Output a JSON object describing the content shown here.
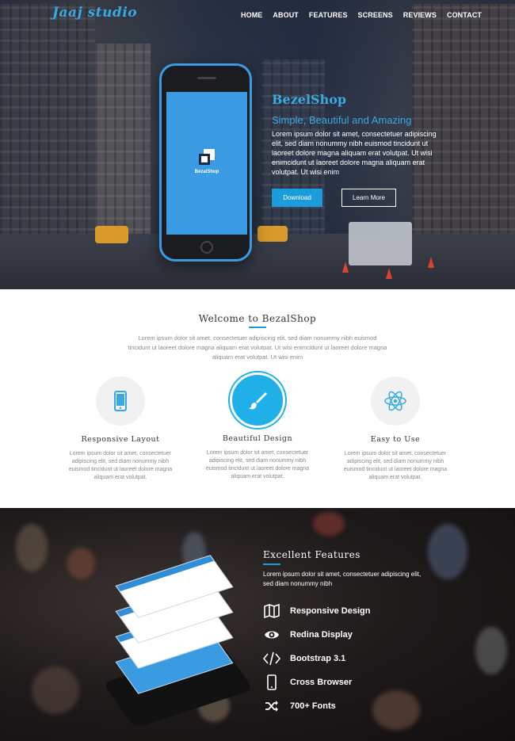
{
  "header": {
    "brand": "Jaaj studio",
    "nav": [
      "HOME",
      "ABOUT",
      "FEATURES",
      "SCREENS",
      "REVIEWS",
      "CONTACT"
    ]
  },
  "hero": {
    "app_name": "BezalShop",
    "title": "BezelShop",
    "subtitle": "Simple, Beautiful and Amazing",
    "text": "Lorem ipsum dolor sit amet, consectetuer adipiscing elit, sed diam nonummy nibh euismod tincidunt ut laoreet dolore magna aliquam erat volutpat. Ut wisi enimcidunt ut laoreet dolore magna aliquam erat volutpat. Ut wisi enim",
    "download_label": "Download",
    "learn_more_label": "Learn More"
  },
  "welcome": {
    "title": "Welcome to BezalShop",
    "text": "Lorem ipsum dolor sit amet, consectetuer adipiscing elit, sed diam nonummy nibh euismod tincidunt ut laoreet dolore magna aliquam erat volutpat. Ut wisi enimcidunt ut laoreet dolore magna aliquam erat volutpat. Ut wisi enim",
    "features": [
      {
        "icon": "mobile-icon",
        "title": "Responsive Layout",
        "text": "Lorem ipsum dolor sit amet, consectetuer adipiscing elit, sed diam nonummy nibh euismod tincidunt ut laoreet dolore magna aliquam erat volutpat."
      },
      {
        "icon": "brush-icon",
        "title": "Beautiful Design",
        "text": "Lorem ipsum dolor sit amet, consectetuer adipiscing elit, sed diam nonummy nibh euismod tincidunt ut laoreet dolore magna aliquam erat volutpat."
      },
      {
        "icon": "atom-icon",
        "title": "Easy to Use",
        "text": "Lorem ipsum dolor sit amet, consectetuer adipiscing elit, sed diam nonummy nibh euismod tincidunt ut laoreet dolore magna aliquam erat volutpat."
      }
    ]
  },
  "features": {
    "title": "Excellent Features",
    "text": "Lorem ipsum dolor sit amet, consectetuer adipiscing elit, sed diam nonummy nibh",
    "items": [
      {
        "icon": "map-icon",
        "label": "Responsive Design"
      },
      {
        "icon": "eye-icon",
        "label": "Redina Display"
      },
      {
        "icon": "code-icon",
        "label": "Bootstrap 3.1"
      },
      {
        "icon": "mobile-icon",
        "label": "Cross Browser"
      },
      {
        "icon": "shuffle-icon",
        "label": "700+ Fonts"
      }
    ]
  },
  "colors": {
    "accent": "#1c9ddb",
    "brand": "#39a9e0"
  }
}
